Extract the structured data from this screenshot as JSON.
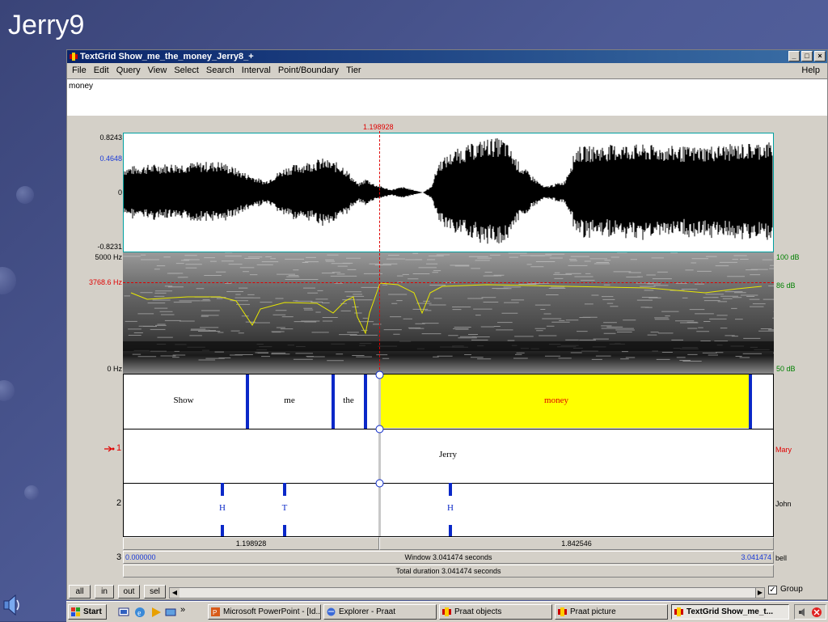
{
  "slide": {
    "title": "Jerry9"
  },
  "window": {
    "title": "TextGrid Show_me_the_money_Jerry8_+",
    "controls": [
      "_",
      "□",
      "×"
    ],
    "menu": [
      "File",
      "Edit",
      "Query",
      "View",
      "Select",
      "Search",
      "Interval",
      "Point/Boundary",
      "Tier"
    ],
    "help": "Help",
    "text_value": "money"
  },
  "editor": {
    "cursor_time": "1.198928",
    "wave_max": "0.8243",
    "wave_mid": "0.4648",
    "wave_zero": "0",
    "wave_min": "-0.8231",
    "spec_top": "5000 Hz",
    "spec_cursor": "3768.6 Hz",
    "spec_bottom": "0 Hz",
    "db_top": "100 dB",
    "db_cursor": "86 dB",
    "db_bottom": "50 dB",
    "tiers": [
      {
        "number": "1",
        "name": "Mary",
        "intervals": [
          "Show",
          "me",
          "the",
          "money"
        ]
      },
      {
        "number": "2",
        "name": "John",
        "intervals": [
          "Jerry"
        ]
      },
      {
        "number": "3",
        "name": "bell",
        "points": [
          "H",
          "T",
          "H"
        ]
      }
    ],
    "left_duration": "1.198928",
    "right_duration": "1.842546",
    "window_start": "0.000000",
    "window_label": "Window 3.041474 seconds",
    "window_end": "3.041474",
    "total_label": "Total duration 3.041474 seconds"
  },
  "bottom": {
    "buttons": [
      "all",
      "in",
      "out",
      "sel"
    ],
    "group_label": "Group",
    "group_checked": true
  },
  "taskbar": {
    "start": "Start",
    "chevron": "»",
    "tasks": [
      "Microsoft PowerPoint - [Id...",
      "Explorer - Praat",
      "Praat objects",
      "Praat picture",
      "TextGrid Show_me_t..."
    ]
  },
  "colors": {
    "boundary": "#0a28c8",
    "selection": "#ffff00",
    "cursor": "#e00000",
    "pitch": "#e8e800"
  }
}
